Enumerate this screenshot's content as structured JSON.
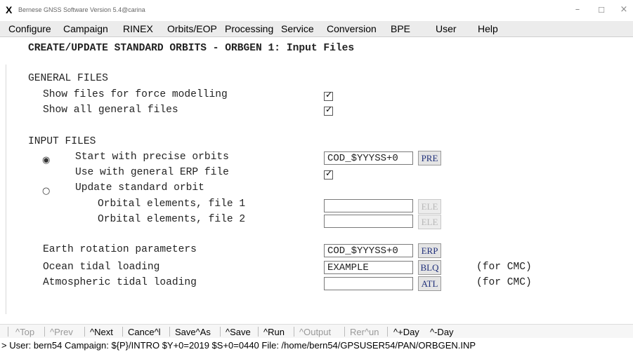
{
  "window": {
    "title": "Bernese GNSS Software Version 5.4@carina",
    "app_icon": "X",
    "controls": {
      "minimize": "–",
      "maximize": "☐",
      "close": "×"
    }
  },
  "menu": [
    "Configure",
    "Campaign",
    "RINEX",
    "Orbits/EOP",
    "Processing",
    "Service",
    "Conversion",
    "BPE",
    "User",
    "Help"
  ],
  "panel": {
    "title": "CREATE/UPDATE STANDARD ORBITS - ORBGEN 1: Input Files",
    "general": {
      "header": "GENERAL FILES",
      "show_force": "Show files for force modelling",
      "show_all": "Show all general files"
    },
    "input": {
      "header": "INPUT FILES",
      "precise_label": "Start with precise orbits",
      "precise_value": "COD_$YYYSS+0",
      "precise_btn": "PRE",
      "erp_use_label": "Use with general ERP file",
      "update_label": "Update standard orbit",
      "ele1_label": "Orbital elements, file 1",
      "ele1_value": "",
      "ele2_label": "Orbital elements, file 2",
      "ele2_value": "",
      "ele_btn": "ELE"
    },
    "params": {
      "erp_label": "Earth rotation parameters",
      "erp_value": "COD_$YYYSS+0",
      "erp_btn": "ERP",
      "otl_label": "Ocean tidal loading",
      "otl_value": "EXAMPLE",
      "otl_btn": "BLQ",
      "otl_note": "(for CMC)",
      "atl_label": "Atmospheric tidal loading",
      "atl_value": "",
      "atl_btn": "ATL",
      "atl_note": "(for CMC)"
    }
  },
  "toolbar": {
    "top": "^Top",
    "prev": "^Prev",
    "next": "^Next",
    "cancel": "Cance^l",
    "saveas": "Save^As",
    "save": "^Save",
    "run": "^Run",
    "output": "^Output",
    "rerun": "Rer^un",
    "plusday": "^+Day",
    "minusday": "^-Day"
  },
  "status": "> User: bern54  Campaign: ${P}/INTRO  $Y+0=2019  $S+0=0440  File: /home/bern54/GPSUSER54/PAN/ORBGEN.INP"
}
